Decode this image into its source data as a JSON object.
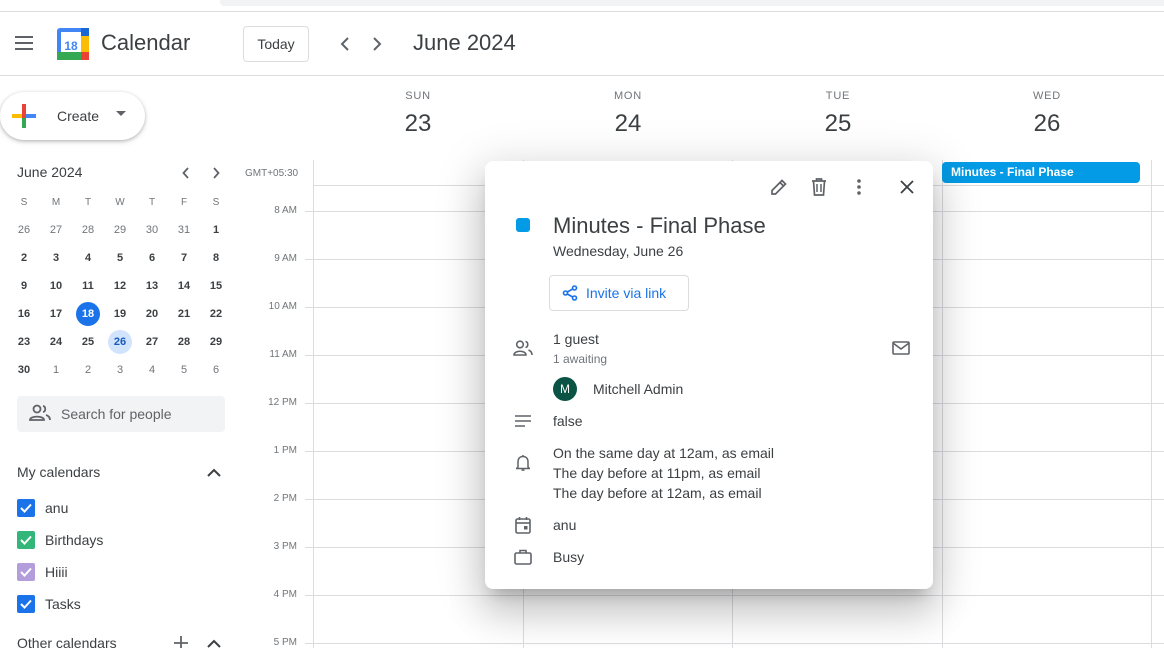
{
  "header": {
    "app_title": "Calendar",
    "logo_day": "18",
    "today_label": "Today",
    "month_title": "June 2024"
  },
  "create": {
    "label": "Create"
  },
  "mini_calendar": {
    "title": "June 2024",
    "weekdays": [
      "S",
      "M",
      "T",
      "W",
      "T",
      "F",
      "S"
    ],
    "weeks": [
      [
        "26",
        "27",
        "28",
        "29",
        "30",
        "31",
        "1"
      ],
      [
        "2",
        "3",
        "4",
        "5",
        "6",
        "7",
        "8"
      ],
      [
        "9",
        "10",
        "11",
        "12",
        "13",
        "14",
        "15"
      ],
      [
        "16",
        "17",
        "18",
        "19",
        "20",
        "21",
        "22"
      ],
      [
        "23",
        "24",
        "25",
        "26",
        "27",
        "28",
        "29"
      ],
      [
        "30",
        "1",
        "2",
        "3",
        "4",
        "5",
        "6"
      ]
    ],
    "today": "18",
    "selected": "26"
  },
  "search_people": {
    "placeholder": "Search for people"
  },
  "my_calendars": {
    "title": "My calendars",
    "items": [
      {
        "label": "anu",
        "color": "#1a73e8"
      },
      {
        "label": "Birthdays",
        "color": "#33b679"
      },
      {
        "label": "Hiiii",
        "color": "#b39ddb"
      },
      {
        "label": "Tasks",
        "color": "#1a73e8"
      }
    ]
  },
  "other_calendars": {
    "title": "Other calendars"
  },
  "grid": {
    "timezone": "GMT+05:30",
    "days": [
      {
        "dow": "SUN",
        "num": "23"
      },
      {
        "dow": "MON",
        "num": "24"
      },
      {
        "dow": "TUE",
        "num": "25"
      },
      {
        "dow": "WED",
        "num": "26"
      }
    ],
    "times": [
      "8 AM",
      "9 AM",
      "10 AM",
      "11 AM",
      "12 PM",
      "1 PM",
      "2 PM",
      "3 PM",
      "4 PM",
      "5 PM"
    ],
    "allday_event": "Minutes - Final Phase"
  },
  "popup": {
    "title": "Minutes - Final Phase",
    "date": "Wednesday, June 26",
    "invite_label": "Invite via link",
    "guests": "1 guest",
    "guests_status": "1 awaiting",
    "guest_initial": "M",
    "guest_name": "Mitchell Admin",
    "description": "false",
    "reminders": [
      "On the same day at 12am, as email",
      "The day before at 11pm, as email",
      "The day before at 12am, as email"
    ],
    "calendar": "anu",
    "availability": "Busy",
    "event_color": "#039be5"
  }
}
